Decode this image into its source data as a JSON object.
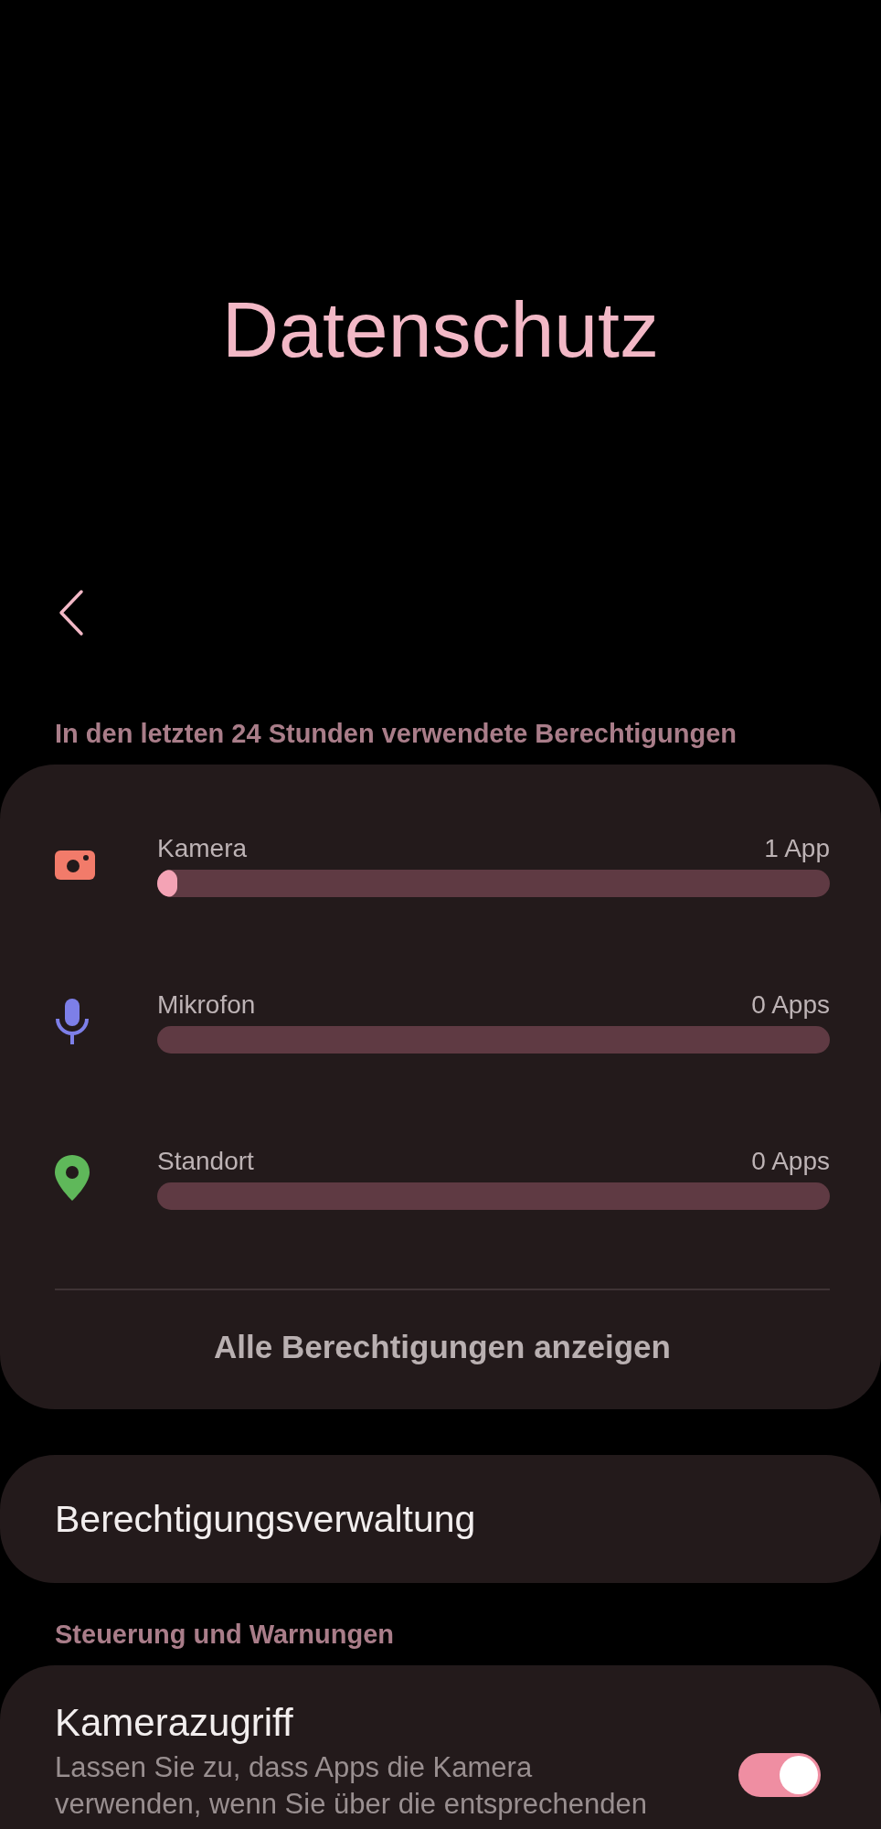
{
  "title": "Datenschutz",
  "recent_section": {
    "header": "In den letzten 24 Stunden verwendete Berechtigungen",
    "items": [
      {
        "kind": "camera",
        "label": "Kamera",
        "count": "1 App",
        "level": 0.03
      },
      {
        "kind": "microphone",
        "label": "Mikrofon",
        "count": "0 Apps"
      },
      {
        "kind": "location",
        "label": "Standort",
        "count": "0 Apps"
      }
    ],
    "link": "Alle Berechtigungen anzeigen"
  },
  "permission_manager": "Berechtigungsverwaltung",
  "controls_section": {
    "header": "Steuerung und Warnungen",
    "items": [
      {
        "title": "Kamerazugriff",
        "description_lines": [
          "Lassen Sie zu, dass Apps die Kamera",
          "verwenden, wenn Sie über die entsprechenden"
        ],
        "on": true
      }
    ]
  }
}
